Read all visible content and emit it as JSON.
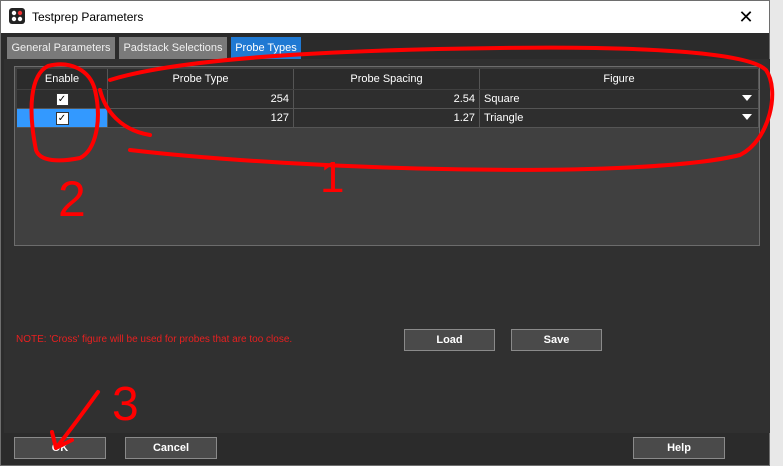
{
  "window": {
    "title": "Testprep Parameters",
    "close_symbol": "✕"
  },
  "tabs": [
    {
      "label": "General Parameters"
    },
    {
      "label": "Padstack Selections"
    },
    {
      "label": "Probe Types"
    }
  ],
  "grid": {
    "columns": [
      "Enable",
      "Probe Type",
      "Probe Spacing",
      "Figure"
    ],
    "rows": [
      {
        "enabled": true,
        "probe_type": "254",
        "probe_spacing": "2.54",
        "figure": "Square"
      },
      {
        "enabled": true,
        "probe_type": "127",
        "probe_spacing": "1.27",
        "figure": "Triangle"
      }
    ],
    "check_glyph": "✓"
  },
  "note": "NOTE: 'Cross' figure will be used for probes that are too close.",
  "buttons": {
    "load": "Load",
    "save": "Save",
    "ok": "OK",
    "cancel": "Cancel",
    "help": "Help"
  },
  "annotations": {
    "one": "1",
    "two": "2",
    "three": "3"
  },
  "colors": {
    "accent": "#1f79d3",
    "note_red": "#e82020",
    "annotation_red": "#ff0000"
  }
}
